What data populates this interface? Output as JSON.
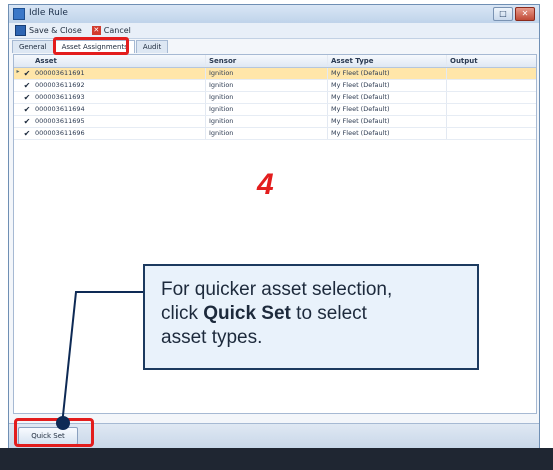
{
  "window": {
    "title": "Idle Rule"
  },
  "toolbar": {
    "save_label": "Save & Close",
    "cancel_label": "Cancel"
  },
  "tabs": [
    {
      "label": "General"
    },
    {
      "label": "Asset Assignments"
    },
    {
      "label": "Audit"
    }
  ],
  "grid": {
    "headers": {
      "asset": "Asset",
      "sensor": "Sensor",
      "type": "Asset Type",
      "output": "Output"
    },
    "rows": [
      {
        "asset": "000003611691",
        "sensor": "Ignition",
        "type": "My Fleet (Default)",
        "output": ""
      },
      {
        "asset": "000003611692",
        "sensor": "Ignition",
        "type": "My Fleet (Default)",
        "output": ""
      },
      {
        "asset": "000003611693",
        "sensor": "Ignition",
        "type": "My Fleet (Default)",
        "output": ""
      },
      {
        "asset": "000003611694",
        "sensor": "Ignition",
        "type": "My Fleet (Default)",
        "output": ""
      },
      {
        "asset": "000003611695",
        "sensor": "Ignition",
        "type": "My Fleet (Default)",
        "output": ""
      },
      {
        "asset": "000003611696",
        "sensor": "Ignition",
        "type": "My Fleet (Default)",
        "output": ""
      }
    ]
  },
  "step_number": "4",
  "callout": {
    "line1": "For quicker asset selection,",
    "line2_pre": "click ",
    "line2_bold": "Quick Set",
    "line2_post": " to select",
    "line3": "asset types."
  },
  "quick_set_label": "Quick Set",
  "colors": {
    "highlight": "#e31d1d",
    "selected_row": "#ffe6a9"
  },
  "icons": {
    "save": "save-icon",
    "cancel": "cancel-icon",
    "checkbox": "check-icon"
  }
}
